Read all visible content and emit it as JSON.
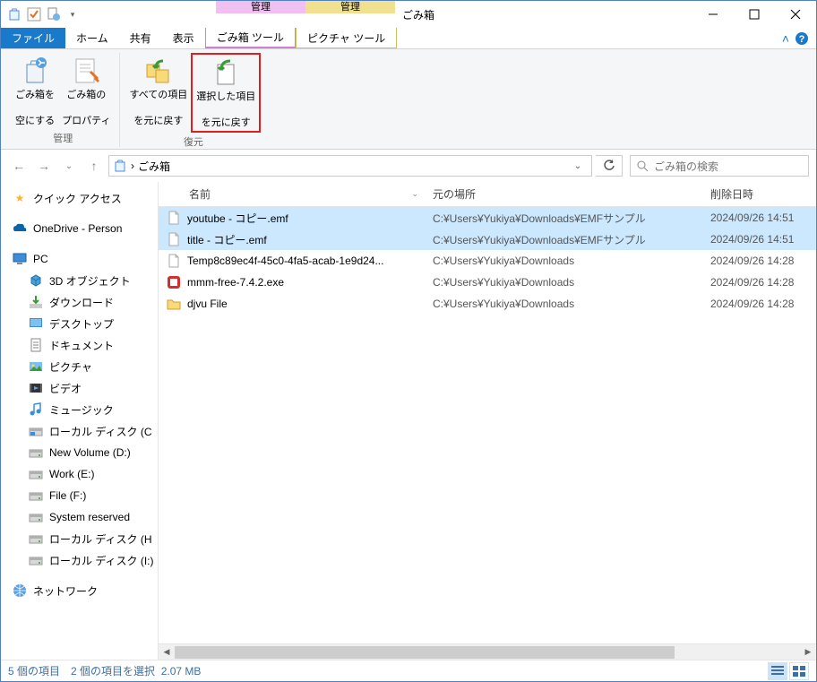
{
  "title": "ごみ箱",
  "context_tabs": [
    {
      "header": "管理",
      "sub": "ごみ箱 ツール"
    },
    {
      "header": "管理",
      "sub": "ピクチャ ツール"
    }
  ],
  "tabs": {
    "file": "ファイル",
    "items": [
      "ホーム",
      "共有",
      "表示"
    ]
  },
  "ribbon": {
    "group1": {
      "label": "管理",
      "btn1": {
        "l1": "ごみ箱を",
        "l2": "空にする"
      },
      "btn2": {
        "l1": "ごみ箱の",
        "l2": "プロパティ"
      }
    },
    "group2": {
      "label": "復元",
      "btn1": {
        "l1": "すべての項目",
        "l2": "を元に戻す"
      },
      "btn2": {
        "l1": "選択した項目",
        "l2": "を元に戻す"
      }
    }
  },
  "address": {
    "text": "ごみ箱",
    "sep": "›"
  },
  "search": {
    "placeholder": "ごみ箱の検索"
  },
  "columns": {
    "name": "名前",
    "loc": "元の場所",
    "date": "削除日時"
  },
  "tree": {
    "quick": "クイック アクセス",
    "onedrive": "OneDrive - Person",
    "pc": "PC",
    "pc_items": [
      "3D オブジェクト",
      "ダウンロード",
      "デスクトップ",
      "ドキュメント",
      "ピクチャ",
      "ビデオ",
      "ミュージック",
      "ローカル ディスク (C",
      "New Volume (D:)",
      "Work (E:)",
      "File (F:)",
      "System reserved",
      "ローカル ディスク (H",
      "ローカル ディスク (I:)"
    ],
    "network": "ネットワーク"
  },
  "rows": [
    {
      "name": "youtube - コピー.emf",
      "loc": "C:¥Users¥Yukiya¥Downloads¥EMFサンプル",
      "date": "2024/09/26 14:51",
      "icon": "file",
      "selected": true
    },
    {
      "name": "title - コピー.emf",
      "loc": "C:¥Users¥Yukiya¥Downloads¥EMFサンプル",
      "date": "2024/09/26 14:51",
      "icon": "file",
      "selected": true
    },
    {
      "name": "Temp8c89ec4f-45c0-4fa5-acab-1e9d24...",
      "loc": "C:¥Users¥Yukiya¥Downloads",
      "date": "2024/09/26 14:28",
      "icon": "file",
      "selected": false
    },
    {
      "name": "mmm-free-7.4.2.exe",
      "loc": "C:¥Users¥Yukiya¥Downloads",
      "date": "2024/09/26 14:28",
      "icon": "exe",
      "selected": false
    },
    {
      "name": "djvu File",
      "loc": "C:¥Users¥Yukiya¥Downloads",
      "date": "2024/09/26 14:28",
      "icon": "folder",
      "selected": false
    }
  ],
  "status": {
    "count": "5 個の項目",
    "selected": "2 個の項目を選択",
    "size": "2.07 MB"
  }
}
